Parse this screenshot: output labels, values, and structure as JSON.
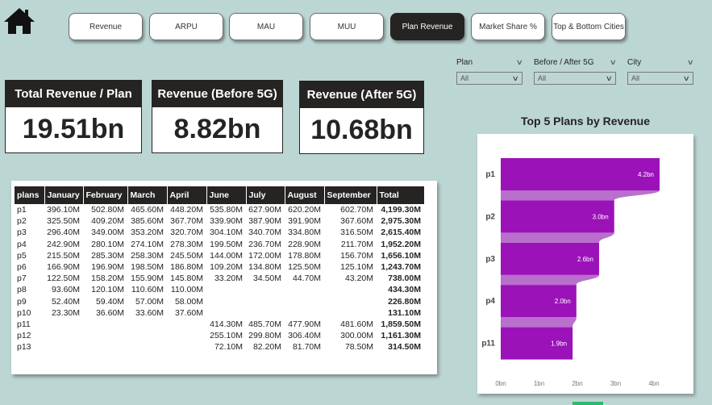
{
  "nav": {
    "home_icon": "home-icon",
    "buttons": [
      {
        "label": "Revenue",
        "active": false
      },
      {
        "label": "ARPU",
        "active": false
      },
      {
        "label": "MAU",
        "active": false
      },
      {
        "label": "MUU",
        "active": false
      },
      {
        "label": "Plan Revenue",
        "active": true
      },
      {
        "label": "Market Share %",
        "active": false
      },
      {
        "label": "Top & Bottom Cities",
        "active": false
      }
    ]
  },
  "filters": [
    {
      "label": "Plan",
      "value": "All"
    },
    {
      "label": "Before / After 5G",
      "value": "All"
    },
    {
      "label": "City",
      "value": "All"
    }
  ],
  "cards": [
    {
      "title": "Total Revenue / Plan",
      "value": "19.51bn"
    },
    {
      "title": "Revenue (Before 5G)",
      "value": "8.82bn"
    },
    {
      "title": "Revenue (After 5G)",
      "value": "10.68bn"
    }
  ],
  "table": {
    "headers": [
      "plans",
      "January",
      "February",
      "March",
      "April",
      "June",
      "July",
      "August",
      "September",
      "Total"
    ],
    "rows": [
      [
        "p1",
        "396.10M",
        "502.80M",
        "465.60M",
        "448.20M",
        "535.80M",
        "627.90M",
        "620.20M",
        "602.70M",
        "4,199.30M"
      ],
      [
        "p2",
        "325.50M",
        "409.20M",
        "385.60M",
        "367.70M",
        "339.90M",
        "387.90M",
        "391.90M",
        "367.60M",
        "2,975.30M"
      ],
      [
        "p3",
        "296.40M",
        "349.00M",
        "353.20M",
        "320.70M",
        "304.10M",
        "340.70M",
        "334.80M",
        "316.50M",
        "2,615.40M"
      ],
      [
        "p4",
        "242.90M",
        "280.10M",
        "274.10M",
        "278.30M",
        "199.50M",
        "236.70M",
        "228.90M",
        "211.70M",
        "1,952.20M"
      ],
      [
        "p5",
        "215.50M",
        "285.30M",
        "258.30M",
        "245.50M",
        "144.00M",
        "172.00M",
        "178.80M",
        "156.70M",
        "1,656.10M"
      ],
      [
        "p6",
        "166.90M",
        "196.90M",
        "198.50M",
        "186.80M",
        "109.20M",
        "134.80M",
        "125.50M",
        "125.10M",
        "1,243.70M"
      ],
      [
        "p7",
        "122.50M",
        "158.20M",
        "155.90M",
        "145.80M",
        "33.20M",
        "34.50M",
        "44.70M",
        "43.20M",
        "738.00M"
      ],
      [
        "p8",
        "93.60M",
        "120.10M",
        "110.60M",
        "110.00M",
        "",
        "",
        "",
        "",
        "434.30M"
      ],
      [
        "p9",
        "52.40M",
        "59.40M",
        "57.00M",
        "58.00M",
        "",
        "",
        "",
        "",
        "226.80M"
      ],
      [
        "p10",
        "23.30M",
        "36.60M",
        "33.60M",
        "37.60M",
        "",
        "",
        "",
        "",
        "131.10M"
      ],
      [
        "p11",
        "",
        "",
        "",
        "",
        "414.30M",
        "485.70M",
        "477.90M",
        "481.60M",
        "1,859.50M"
      ],
      [
        "p12",
        "",
        "",
        "",
        "",
        "255.10M",
        "299.80M",
        "306.40M",
        "300.00M",
        "1,161.30M"
      ],
      [
        "p13",
        "",
        "",
        "",
        "",
        "72.10M",
        "82.20M",
        "81.70M",
        "78.50M",
        "314.50M"
      ]
    ]
  },
  "chart_data": {
    "type": "bar",
    "orientation": "horizontal",
    "title": "Top 5 Plans  by  Revenue",
    "categories": [
      "p1",
      "p2",
      "p3",
      "p4",
      "p11"
    ],
    "values": [
      4.2,
      3.0,
      2.6,
      2.0,
      1.9
    ],
    "data_labels": [
      "4.2bn",
      "3.0bn",
      "2.6bn",
      "2.0bn",
      "1.9bn"
    ],
    "xticks": [
      "0bn",
      "1bn",
      "2bn",
      "3bn",
      "4bn"
    ],
    "xlim": [
      0,
      4.2
    ],
    "bar_color": "#9b12b8",
    "ribbon_color": "#b96fcc",
    "grid": false
  },
  "colors": {
    "background": "#bcd6d3",
    "dark": "#252423",
    "accent": "#9b12b8"
  }
}
